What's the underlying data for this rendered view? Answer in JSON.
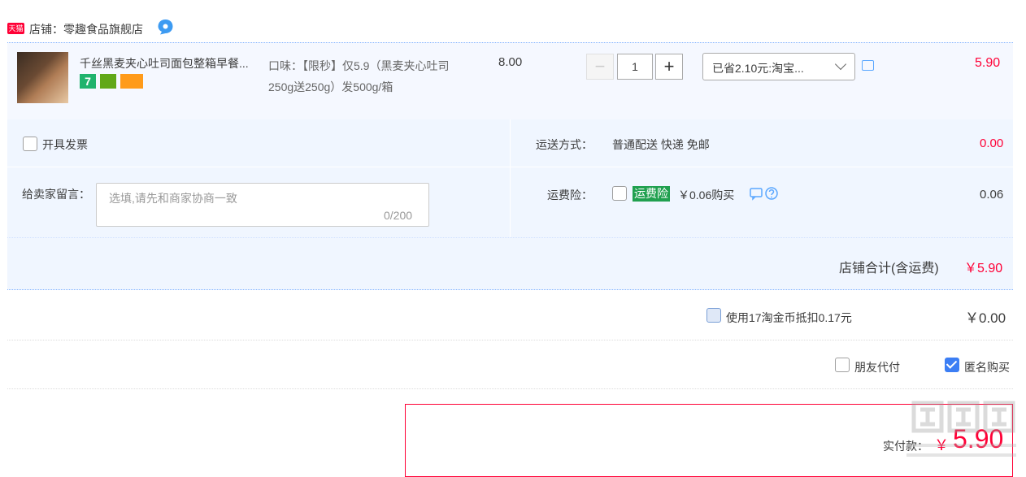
{
  "shop": {
    "logo_text": "天猫",
    "label": "店铺：零趣食品旗舰店"
  },
  "item": {
    "title": "千丝黑麦夹心吐司面包整箱早餐...",
    "sku": "口味：【限秒】仅5.9（黑麦夹心吐司250g送250g）发500g/箱",
    "unit_price": "8.00",
    "qty_minus": "−",
    "qty": "1",
    "qty_plus": "+",
    "badge_seven": "7",
    "promo": "已省2.10元:淘宝...",
    "total": "5.90"
  },
  "invoice": {
    "label": "开具发票"
  },
  "shipping": {
    "label": "运送方式：",
    "value": "普通配送 快递 免邮",
    "fee": "0.00"
  },
  "memo": {
    "label": "给卖家留言：",
    "placeholder": "选填,请先和商家协商一致",
    "count": "0/200"
  },
  "insurance": {
    "label": "运费险：",
    "tag": "运费险",
    "price": "￥0.06购买",
    "fee": "0.06"
  },
  "shop_total": {
    "label": "店铺合计(含运费)",
    "value": "￥5.90"
  },
  "coins": {
    "label": "使用17淘金币抵扣0.17元",
    "value": "￥0.00"
  },
  "options": {
    "friend_pay": "朋友代付",
    "anonymous": "匿名购买"
  },
  "payment": {
    "label": "实付款：",
    "yen": "￥",
    "value": "5.90"
  },
  "colors": {
    "accent_red": "#ff0036",
    "blue_bg": "#f0f6ff",
    "checkbox_blue": "#3c7ef4",
    "insurance_green": "#20a04f"
  },
  "icons": [
    "tmall-logo",
    "wangwang-icon",
    "message-icon",
    "help-icon",
    "chevron-down-icon",
    "checkmark-icon"
  ]
}
